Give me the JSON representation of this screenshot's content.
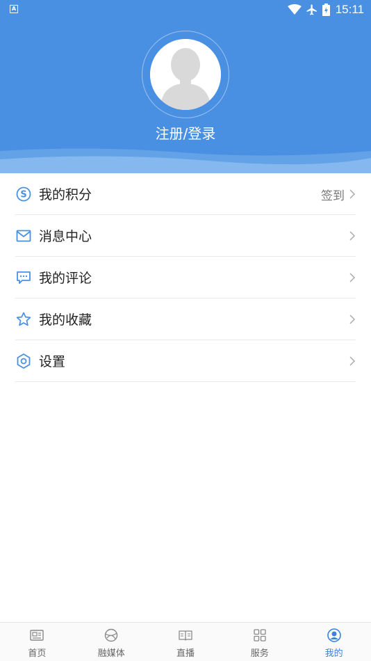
{
  "status_bar": {
    "time": "15:11",
    "left_icon": "A"
  },
  "profile": {
    "login_text": "注册/登录"
  },
  "menu": {
    "items": [
      {
        "label": "我的积分",
        "extra": "签到",
        "icon": "points-icon"
      },
      {
        "label": "消息中心",
        "extra": "",
        "icon": "mail-icon"
      },
      {
        "label": "我的评论",
        "extra": "",
        "icon": "comment-icon"
      },
      {
        "label": "我的收藏",
        "extra": "",
        "icon": "star-icon"
      },
      {
        "label": "设置",
        "extra": "",
        "icon": "gear-icon"
      }
    ]
  },
  "bottom_nav": {
    "items": [
      {
        "label": "首页",
        "icon": "news-icon",
        "active": false
      },
      {
        "label": "融媒体",
        "icon": "globe-icon",
        "active": false
      },
      {
        "label": "直播",
        "icon": "book-icon",
        "active": false
      },
      {
        "label": "服务",
        "icon": "grid-icon",
        "active": false
      },
      {
        "label": "我的",
        "icon": "user-icon",
        "active": true
      }
    ]
  },
  "colors": {
    "header_bg": "#4a90e2",
    "accent": "#3b82d8",
    "icon_blue": "#4a90e2"
  }
}
